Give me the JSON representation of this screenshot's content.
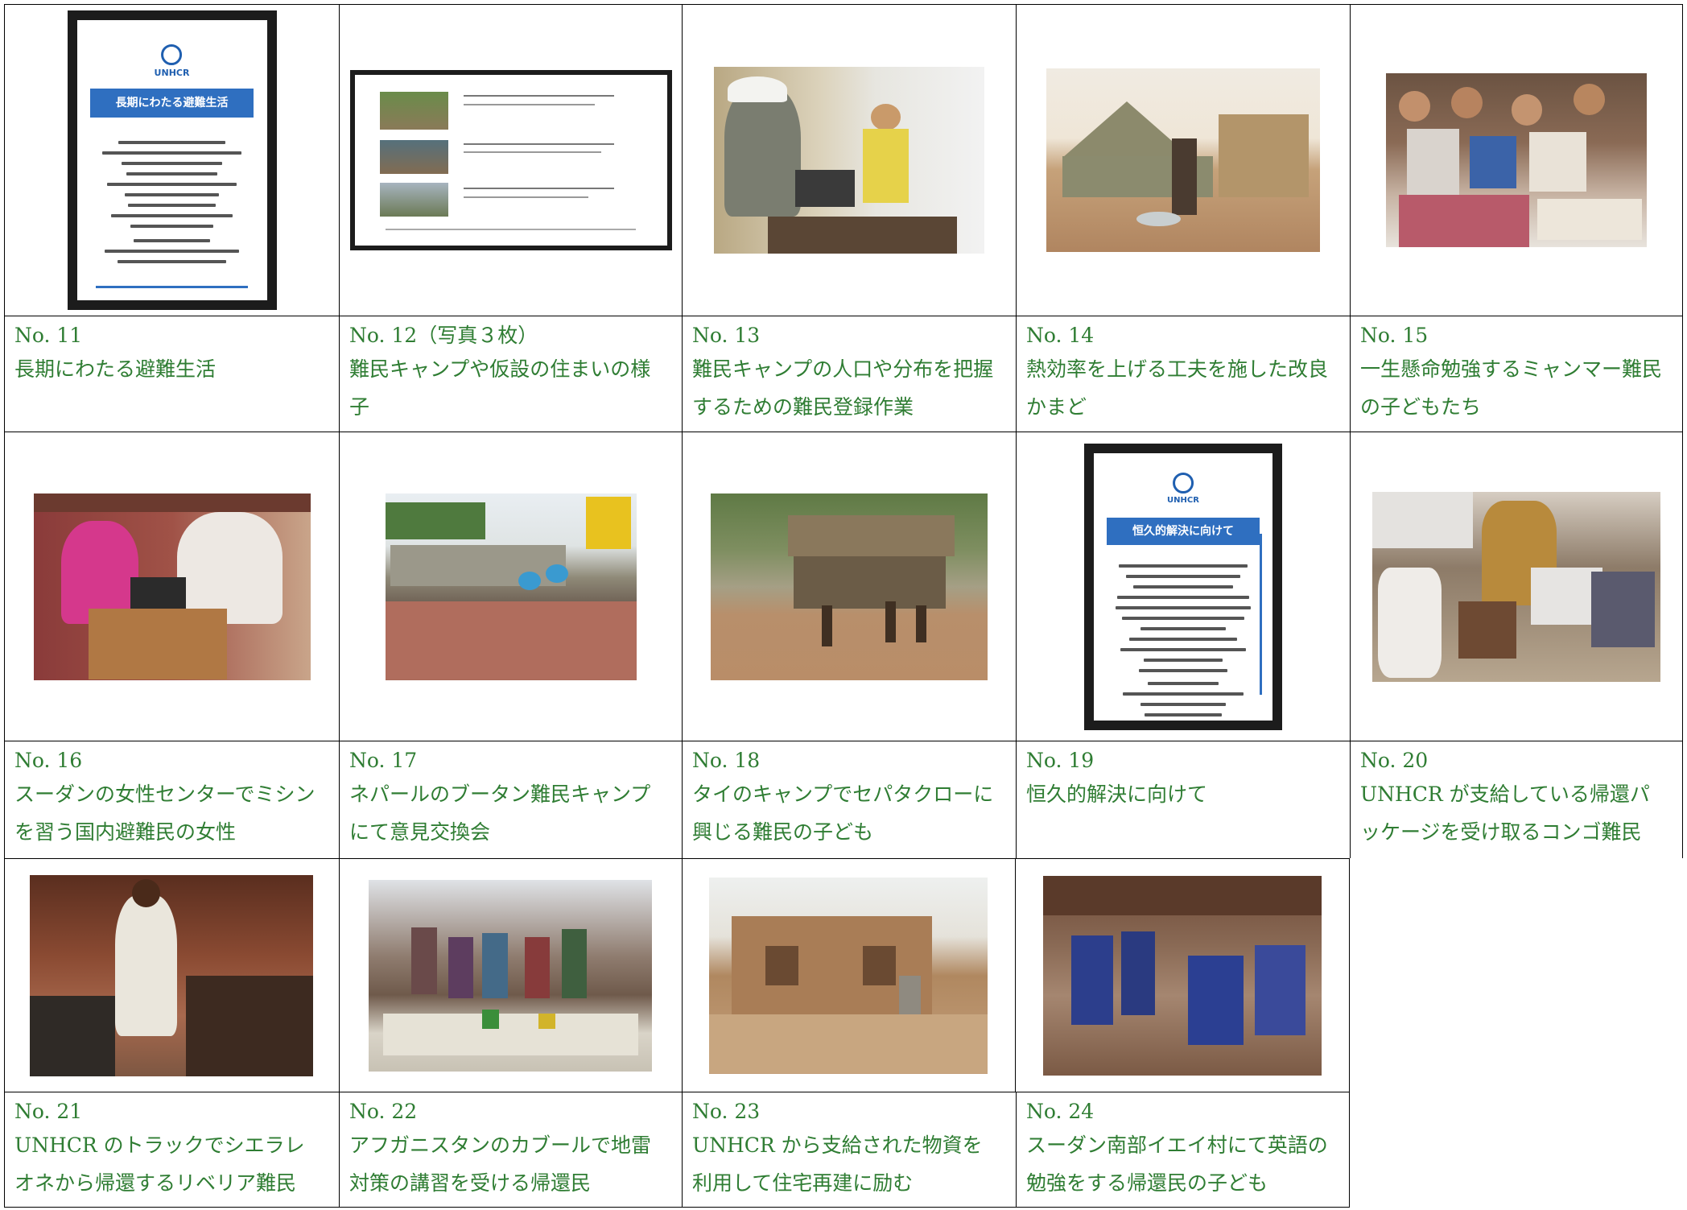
{
  "rows": [
    {
      "cells": [
        {
          "no": "No. 11",
          "desc": "長期にわたる避難生活",
          "image": "poster-image"
        },
        {
          "no": "No. 12（写真３枚）",
          "desc": "難民キャンプや仮設の住まいの様子",
          "image": "panel-image"
        },
        {
          "no": "No. 13",
          "desc": "難民キャンプの人口や分布を把握するための難民登録作業",
          "image": "photo"
        },
        {
          "no": "No. 14",
          "desc": "熱効率を上げる工夫を施した改良かまど",
          "image": "photo"
        },
        {
          "no": "No. 15",
          "desc": "一生懸命勉強するミャンマー難民の子どもたち",
          "image": "photo"
        }
      ]
    },
    {
      "cells": [
        {
          "no": "No. 16",
          "desc": "スーダンの女性センターでミシンを習う国内避難民の女性",
          "image": "photo"
        },
        {
          "no": "No. 17",
          "desc": "ネパールのブータン難民キャンプにて意見交換会",
          "image": "photo"
        },
        {
          "no": "No. 18",
          "desc": "タイのキャンプでセパタクローに興じる難民の子ども",
          "image": "photo"
        },
        {
          "no": "No. 19",
          "desc": "恒久的解決に向けて",
          "image": "poster-image"
        },
        {
          "no": "No. 20",
          "desc": "UNHCR が支給している帰還パッケージを受け取るコンゴ難民",
          "image": "photo"
        }
      ]
    },
    {
      "cells": [
        {
          "no": "No. 21",
          "desc": "UNHCR のトラックでシエラレオネから帰還するリベリア難民",
          "image": "photo"
        },
        {
          "no": "No. 22",
          "desc": "アフガニスタンのカブールで地雷対策の講習を受ける帰還民",
          "image": "photo"
        },
        {
          "no": "No. 23",
          "desc": "UNHCR から支給された物資を利用して住宅再建に励む",
          "image": "photo"
        },
        {
          "no": "No. 24",
          "desc": "スーダン南部イエイ村にて英語の勉強をする帰還民の子ども",
          "image": "photo"
        }
      ]
    }
  ],
  "posters": {
    "p11": {
      "logo": "UNHCR",
      "title": "長期にわたる避難生活"
    },
    "p19": {
      "logo": "UNHCR",
      "title": "恒久的解決に向けて"
    }
  },
  "colors": {
    "caption": "#2f7d33",
    "border": "#000000",
    "poster_blue": "#2f6fc0"
  }
}
